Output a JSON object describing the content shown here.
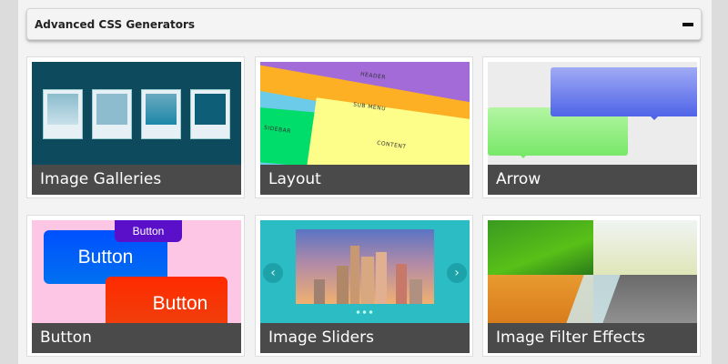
{
  "section": {
    "title": "Advanced CSS Generators",
    "collapse_icon": "minus-icon"
  },
  "cards": [
    {
      "label": "Image Galleries"
    },
    {
      "label": "Layout",
      "thumb_text": {
        "header": "HEADER",
        "submenu": "SUB MENU",
        "sidebar": "SIDEBAR",
        "content": "CONTENT"
      }
    },
    {
      "label": "Arrow"
    },
    {
      "label": "Button",
      "thumb_text": {
        "small": "Button",
        "blue": "Button",
        "red": "Button"
      }
    },
    {
      "label": "Image Sliders"
    },
    {
      "label": "Image Filter Effects"
    }
  ],
  "colors": {
    "caption_bg": "#4a4a4a",
    "gallery_bg": "#0d4a5e",
    "slider_bg": "#2bbcc4",
    "button_bg": "#fcc6e4"
  }
}
